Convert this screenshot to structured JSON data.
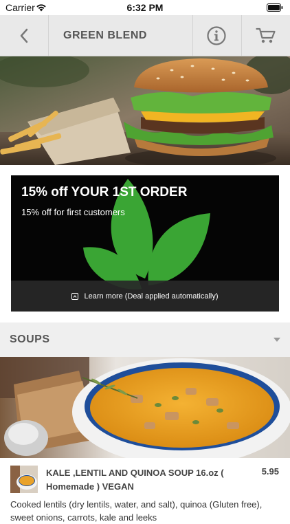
{
  "status_bar": {
    "carrier": "Carrier",
    "time": "6:32 PM"
  },
  "nav": {
    "title": "GREEN BLEND"
  },
  "promo": {
    "title": "15% off YOUR 1ST ORDER",
    "subtitle": "15% off for first customers",
    "footer": "Learn more (Deal applied automatically)"
  },
  "section": {
    "title": "SOUPS"
  },
  "item": {
    "name": "KALE ,LENTIL AND QUINOA SOUP 16.oz ( Homemade ) VEGAN",
    "price": "5.95",
    "description": "Cooked lentils (dry lentils, water, and salt), quinoa (Gluten free), sweet onions, carrots, kale and leeks"
  },
  "colors": {
    "leaf_green": "#3aa534",
    "nav_bg": "#e9e9e9",
    "section_bg": "#efefef"
  },
  "icons": [
    "wifi-icon",
    "battery-icon",
    "back-icon",
    "info-icon",
    "cart-icon",
    "external-link-icon",
    "chevron-down-icon"
  ]
}
